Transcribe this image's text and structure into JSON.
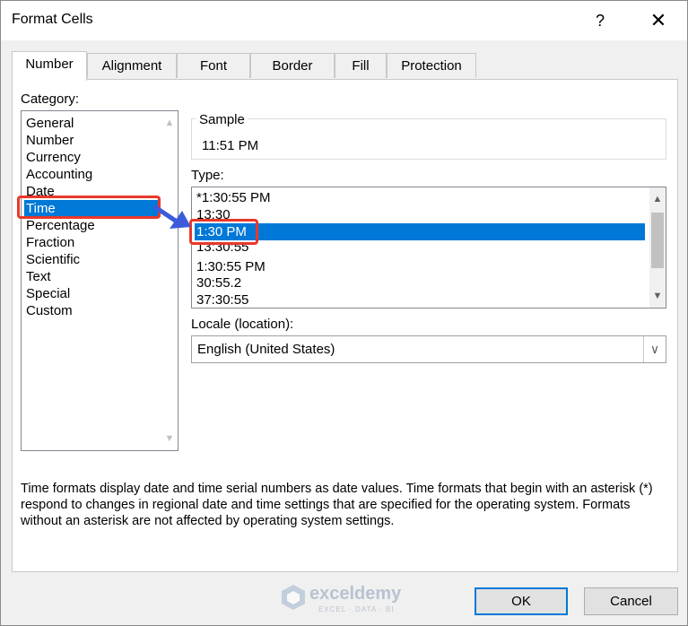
{
  "window": {
    "title": "Format Cells",
    "help": "?",
    "close": "✕"
  },
  "tabs": [
    {
      "label": "Number",
      "active": true
    },
    {
      "label": "Alignment"
    },
    {
      "label": "Font"
    },
    {
      "label": "Border"
    },
    {
      "label": "Fill"
    },
    {
      "label": "Protection"
    }
  ],
  "category": {
    "label": "Category:",
    "items": [
      "General",
      "Number",
      "Currency",
      "Accounting",
      "Date",
      "Time",
      "Percentage",
      "Fraction",
      "Scientific",
      "Text",
      "Special",
      "Custom"
    ],
    "selected": "Time"
  },
  "sample": {
    "label": "Sample",
    "value": "11:51 PM"
  },
  "type": {
    "label": "Type:",
    "items": [
      "*1:30:55 PM",
      "13:30",
      "1:30 PM",
      "13:30:55",
      "1:30:55 PM",
      "30:55.2",
      "37:30:55"
    ],
    "selected": "1:30 PM"
  },
  "locale": {
    "label": "Locale (location):",
    "value": "English (United States)"
  },
  "description": "Time formats display date and time serial numbers as date values.  Time formats that begin with an asterisk (*) respond to changes in regional date and time settings that are specified for the operating system. Formats without an asterisk are not affected by operating system settings.",
  "buttons": {
    "ok": "OK",
    "cancel": "Cancel"
  },
  "watermark": {
    "name": "exceldemy",
    "tagline": "EXCEL · DATA · BI"
  },
  "annotation_color": "#e8382a",
  "arrow_color": "#3b5bdb",
  "selection_color": "#0078d7"
}
